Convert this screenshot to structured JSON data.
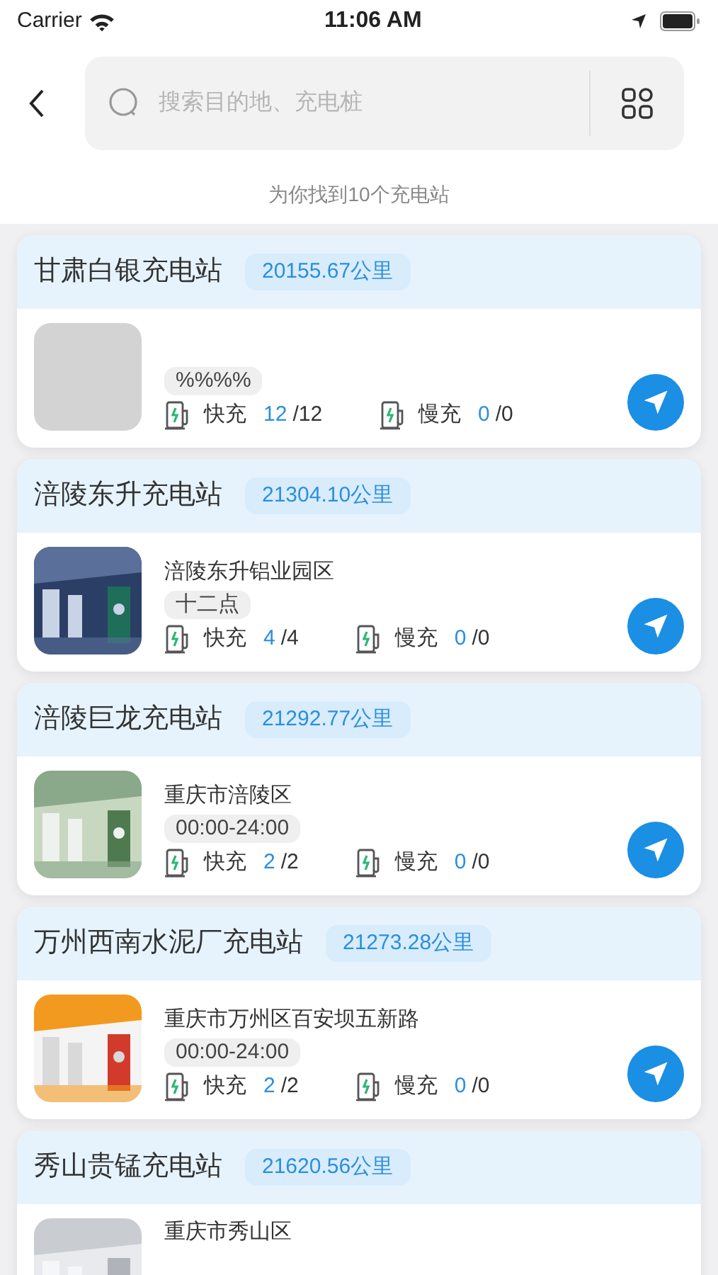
{
  "status_bar": {
    "carrier": "Carrier",
    "time": "11:06 AM"
  },
  "search": {
    "placeholder": "搜索目的地、充电桩"
  },
  "result_count": "为你找到10个充电站",
  "stations": [
    {
      "name": "甘肃白银充电站",
      "distance": "20155.67公里",
      "photo": {
        "kind": "placeholder"
      },
      "hours": "%%%%",
      "fast": {
        "label": "快充",
        "free": "12",
        "total": "/12"
      },
      "slow": {
        "label": "慢充",
        "free": "0",
        "total": "/0"
      }
    },
    {
      "name": "涪陵东升充电站",
      "distance": "21304.10公里",
      "address": "涪陵东升铝业园区",
      "hours": "十二点",
      "fast": {
        "label": "快充",
        "free": "4",
        "total": "/4"
      },
      "slow": {
        "label": "慢充",
        "free": "0",
        "total": "/0"
      }
    },
    {
      "name": "涪陵巨龙充电站",
      "distance": "21292.77公里",
      "address": "重庆市涪陵区",
      "hours": "00:00-24:00",
      "fast": {
        "label": "快充",
        "free": "2",
        "total": "/2"
      },
      "slow": {
        "label": "慢充",
        "free": "0",
        "total": "/0"
      }
    },
    {
      "name": "万州西南水泥厂充电站",
      "distance": "21273.28公里",
      "address": "重庆市万州区百安坝五新路",
      "hours": "00:00-24:00",
      "fast": {
        "label": "快充",
        "free": "2",
        "total": "/2"
      },
      "slow": {
        "label": "慢充",
        "free": "0",
        "total": "/0"
      }
    },
    {
      "name": "秀山贵锰充电站",
      "distance": "21620.56公里",
      "address": "重庆市秀山区"
    }
  ]
}
